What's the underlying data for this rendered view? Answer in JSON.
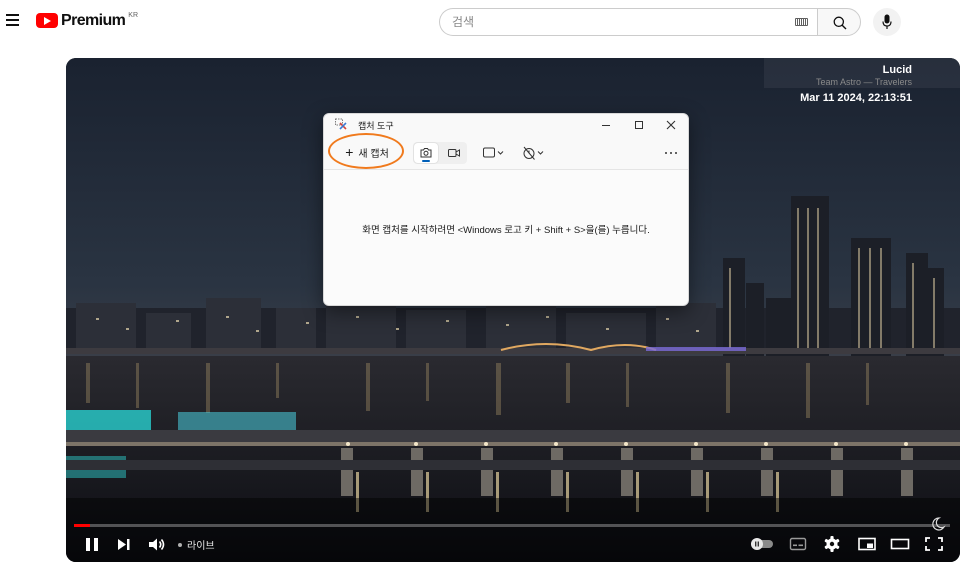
{
  "header": {
    "brand": "Premium",
    "country": "KR",
    "search_placeholder": "검색"
  },
  "video": {
    "overlay": {
      "title": "Lucid",
      "artist": "Team Astro — Travelers",
      "datetime": "Mar 11 2024, 22:13:51"
    },
    "live_label": "라이브",
    "progress": 0.018
  },
  "snipping_tool": {
    "title": "캡처 도구",
    "new_capture_label": "새 캡처",
    "message": "화면 캡처를 시작하려면 <Windows 로고 키 + Shift + S>을(를) 누릅니다.",
    "highlight_color": "#f07a1d",
    "accent_color": "#005fb8"
  },
  "colors": {
    "youtube_red": "#ff0000",
    "live_red": "#ff0000"
  }
}
